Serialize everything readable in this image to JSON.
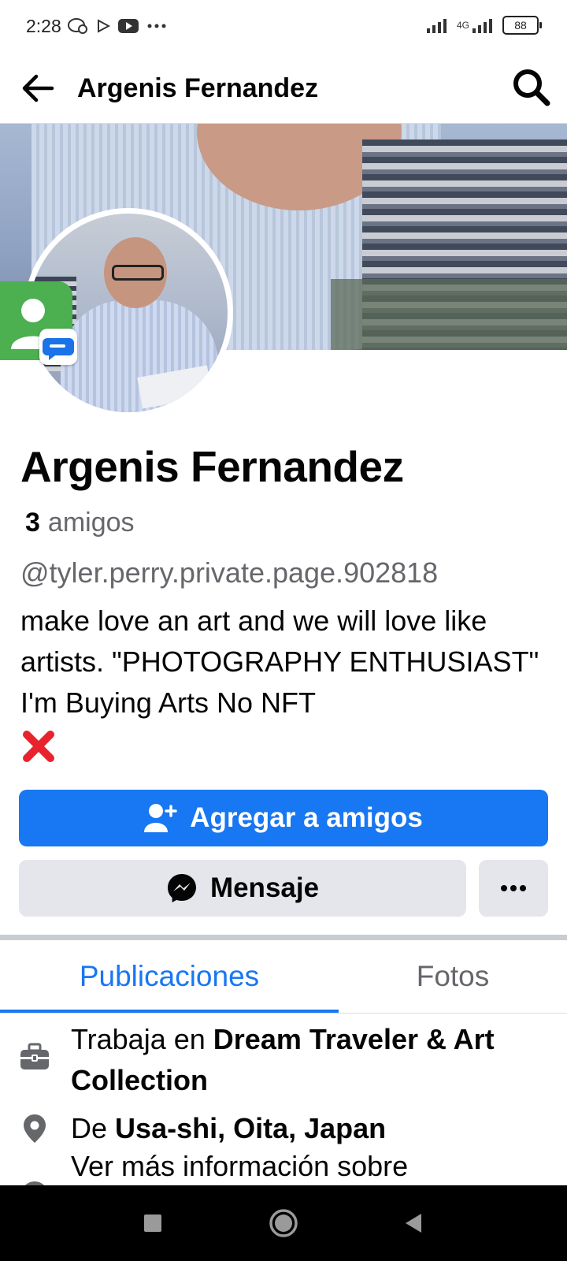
{
  "status_bar": {
    "time": "2:28",
    "network": "4G",
    "battery": "88"
  },
  "header": {
    "title": "Argenis Fernandez"
  },
  "profile": {
    "name": "Argenis Fernandez",
    "friends_count": "3",
    "friends_label": "amigos",
    "username": "@tyler.perry.private.page.902818",
    "bio": "make love an art and we will love like artists. \"PHOTOGRAPHY ENTHUSIAST\" I'm Buying Arts No NFT"
  },
  "actions": {
    "add_friend_label": "Agregar a amigos",
    "message_label": "Mensaje"
  },
  "tabs": [
    {
      "label": "Publicaciones",
      "active": true
    },
    {
      "label": "Fotos",
      "active": false
    }
  ],
  "details": {
    "work_prefix": "Trabaja en",
    "work_place": "Dream Traveler & Art Collection",
    "from_prefix": "De",
    "from_place": "Usa-shi, Oita, Japan",
    "see_more": "Ver más información sobre"
  },
  "colors": {
    "primary": "#1877f2",
    "secondary_button": "#e4e6eb",
    "muted_text": "#65676b"
  },
  "icons": {
    "back": "arrow-left-icon",
    "search": "search-icon",
    "add_friend": "user-plus-icon",
    "message": "messenger-icon",
    "more": "more-horizontal-icon",
    "work": "briefcase-icon",
    "location": "location-pin-icon",
    "nav_recents": "square-icon",
    "nav_home": "circle-icon",
    "nav_back": "triangle-back-icon"
  }
}
